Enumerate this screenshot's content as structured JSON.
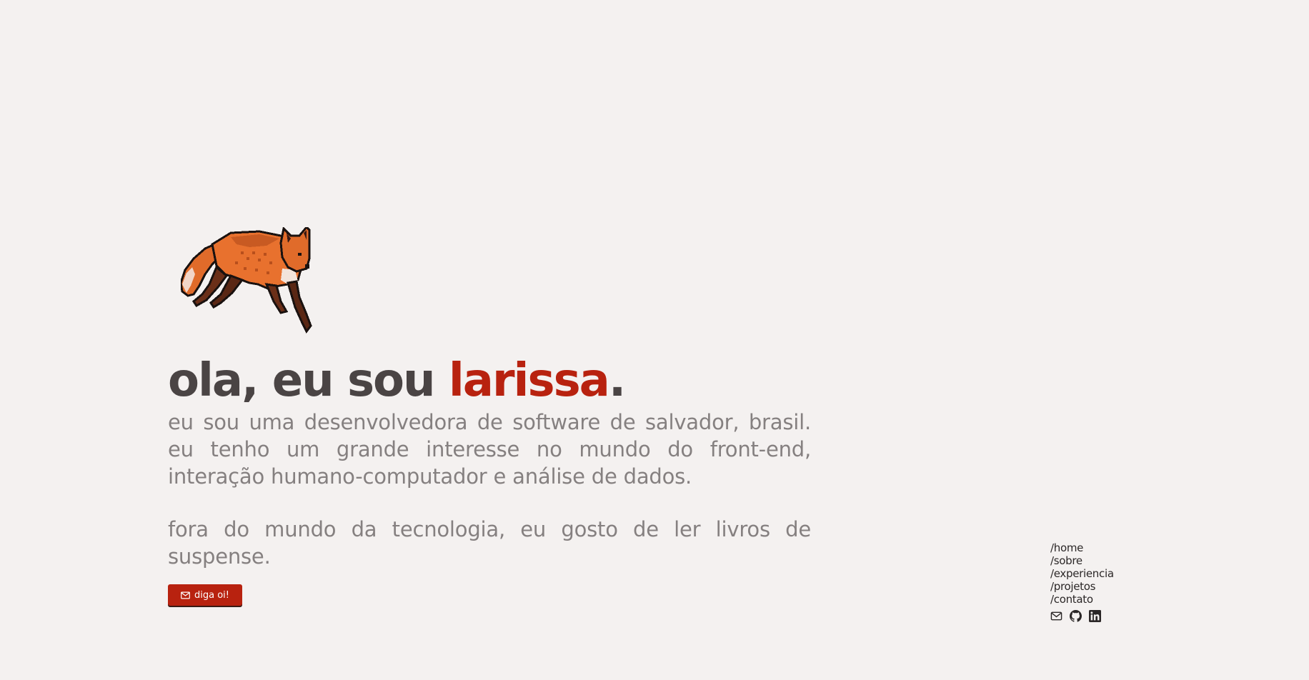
{
  "hero": {
    "fox_image": "pixel-fox-running",
    "greeting": "ola, eu sou ",
    "name": "larissa",
    "period": ".",
    "bio_1": "eu sou uma desenvolvedora de software de salvador, brasil. eu tenho um grande interesse no mundo do front-end, interação humano-computador e análise de dados.",
    "bio_2": "fora do mundo da tecnologia, eu gosto de ler livros de suspense.",
    "cta_label": "diga oi!",
    "cta_icon": "mail-icon"
  },
  "nav": {
    "items": [
      {
        "label": "/home"
      },
      {
        "label": "/sobre"
      },
      {
        "label": "/experiencia"
      },
      {
        "label": "/projetos"
      },
      {
        "label": "/contato"
      }
    ],
    "socials": [
      {
        "icon": "mail-icon"
      },
      {
        "icon": "github-icon"
      },
      {
        "icon": "linkedin-icon"
      }
    ]
  },
  "colors": {
    "background": "#f4f1f0",
    "accent": "#b8220f",
    "heading": "#4a4444",
    "body_text": "#858080",
    "nav_text": "#2b2727"
  }
}
